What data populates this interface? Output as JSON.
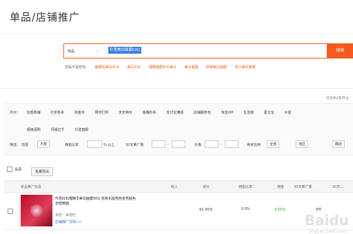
{
  "page": {
    "title": "单品/店铺推广"
  },
  "search": {
    "category": "商品",
    "query": "升思美白面膜50G",
    "button": "搜索"
  },
  "hot": {
    "lead": "您是不是想找：",
    "items": [
      "面膜贴美白补水",
      "美白补水",
      "睡眠面膜补水美白",
      "美白面膜",
      "欧莱美白面膜",
      "男士美白面膜"
    ]
  },
  "result_count": "共找到2条符合",
  "categories": {
    "lead": "类目：",
    "row1": [
      "全部商铺",
      "打折秒杀",
      "淘金币",
      "限时打折",
      "天天特价",
      "金猪秒杀",
      "支付宝满返",
      "店铺服务包",
      "淘宝VIP",
      "生活馆",
      "嘉分宝",
      "大促"
    ],
    "row2": [
      "超级团购",
      "月销过千",
      "只选直邮"
    ]
  },
  "filters": {
    "lead": "筛选：",
    "range_label": "范围",
    "range_value": "不限",
    "commission_label": "佣金比率",
    "commission_suffix": "% 以上",
    "promo_label": "30天推广量",
    "price_label": "价格",
    "seller_label": "卖家信用",
    "seller_value": "全部",
    "region_value": "地区",
    "confirm": "确定",
    "dash": "-"
  },
  "actions": {
    "select_all": "全选",
    "batch": "批量导出"
  },
  "table": {
    "headers": [
      "单品推广信息",
      "收入",
      "单价",
      "佣金比率",
      "佣金",
      "30天推广量",
      "30天…"
    ]
  },
  "product": {
    "title": "升思红石榴精华美白面膜50G 抗氧化提亮色变亮肤色去暗黄面",
    "shop": "掌柜：美德旺",
    "link": "店铺推广详情>>",
    "price": "91.00元",
    "rate": "5.0%",
    "commission": "4.55元",
    "volume": "0件"
  },
  "watermark": {
    "brand": "Baidu",
    "url": "jingyan.baidu.com"
  },
  "colors": {
    "accent": "#f25a1f",
    "link": "#3b6fc9",
    "green": "#2a9d2a"
  }
}
